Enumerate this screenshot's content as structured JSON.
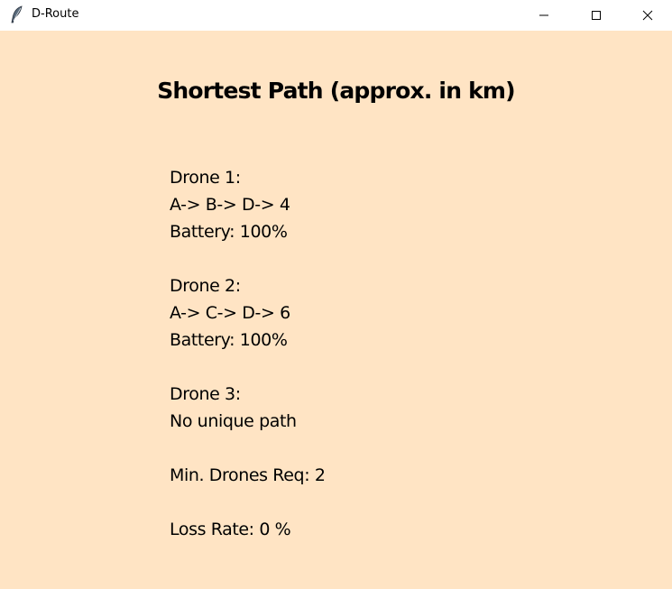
{
  "window": {
    "title": "D-Route",
    "icon": "feather-icon",
    "controls": [
      "minimize-icon",
      "maximize-icon",
      "close-icon"
    ]
  },
  "content": {
    "background": "#ffe4c4",
    "heading": "Shortest Path (approx. in km)",
    "drones": [
      {
        "label": "Drone 1:",
        "path": "A-> B-> D-> 4",
        "battery": "Battery: 100%"
      },
      {
        "label": "Drone 2:",
        "path": "A-> C-> D-> 6",
        "battery": "Battery: 100%"
      },
      {
        "label": "Drone 3:",
        "path": "No unique path"
      }
    ],
    "min_drones": "Min. Drones Req: 2",
    "loss_rate": "Loss Rate: 0 %"
  }
}
